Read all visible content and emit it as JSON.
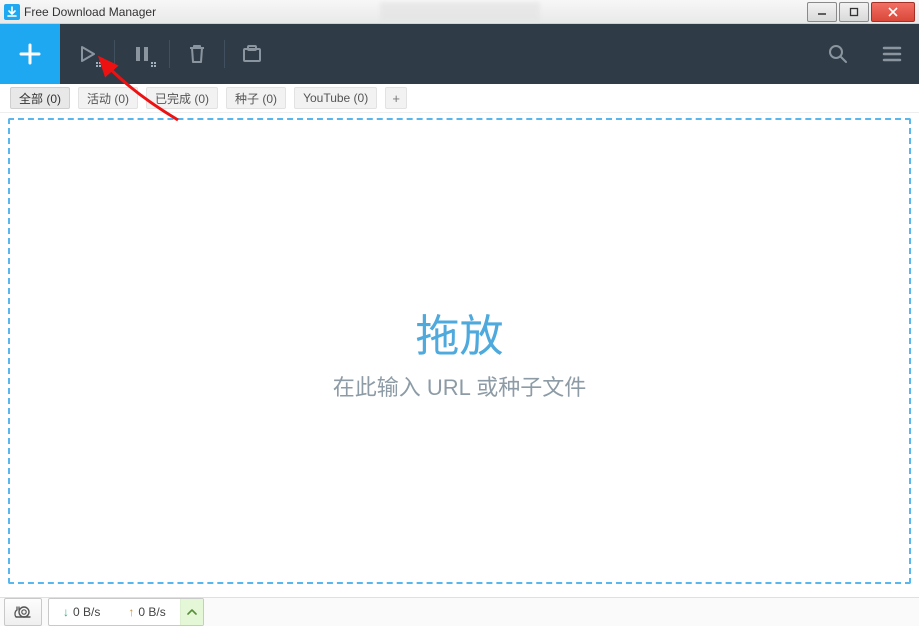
{
  "window": {
    "title": "Free Download Manager"
  },
  "toolbar": {
    "add": "+"
  },
  "tabs": [
    {
      "label": "全部 (0)",
      "active": true
    },
    {
      "label": "活动 (0)",
      "active": false
    },
    {
      "label": "已完成 (0)",
      "active": false
    },
    {
      "label": "种子 (0)",
      "active": false
    },
    {
      "label": "YouTube (0)",
      "active": false
    }
  ],
  "tab_add": "+",
  "dropzone": {
    "title": "拖放",
    "subtitle": "在此输入 URL 或种子文件"
  },
  "status": {
    "down_arrow": "↓",
    "down_speed": "0 B/s",
    "up_arrow": "↑",
    "up_speed": "0 B/s"
  },
  "colors": {
    "accent": "#1ea8f2",
    "toolbar_bg": "#2f3b47",
    "drop_border": "#59b7ef"
  }
}
